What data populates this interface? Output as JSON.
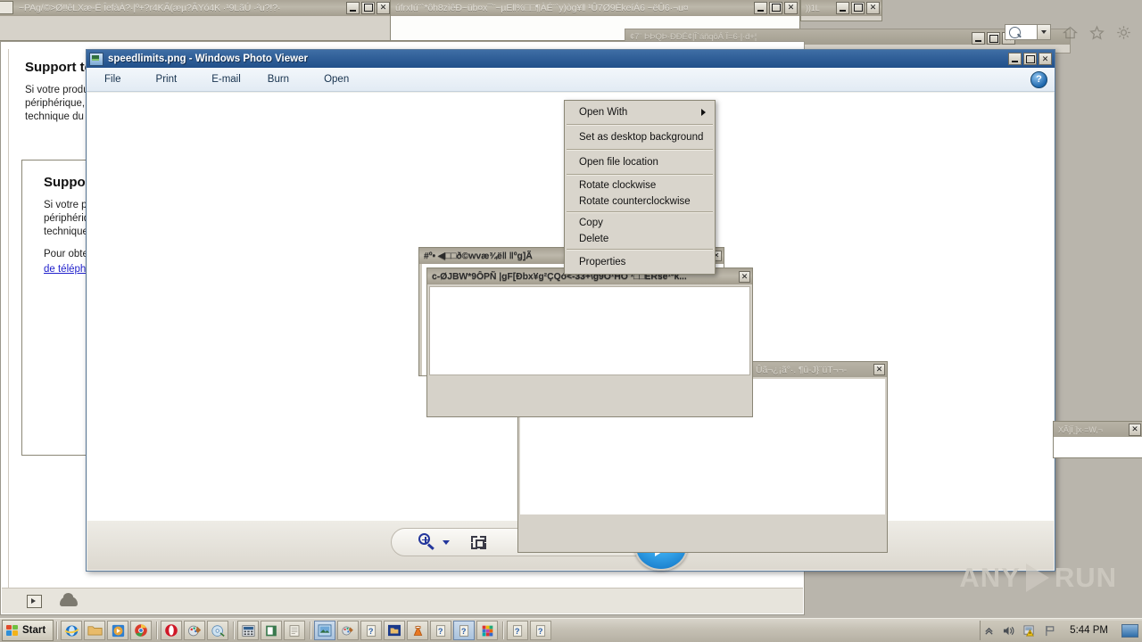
{
  "desktop": {
    "background_color": "#b9b5ac"
  },
  "background_windows": [
    {
      "title": "~PAg/©>Ø‼êLXæ-Ë ÎefàÀ?·|º+?r4KÃ(æµ?ÃYó4K ·¹9LãÚ ·²u?!?·",
      "controls": [
        "minimize",
        "maximize",
        "close"
      ]
    },
    {
      "title": "úfrxIú¨`*ôh8zìêÐ~üb¤x¯¨~µE‖%□□¶ÀÉ¨`y)òg¥‖ ¹Û7Ø9ÈkeíÁ6 ~ëÛ6·¬u¤",
      "controls": [
        "minimize",
        "maximize",
        "close"
      ]
    },
    {
      "title": "))1L",
      "controls": [
        "minimize",
        "maximize",
        "close"
      ]
    },
    {
      "title": "¢7¨ ÞÞQÞ·ÐÐÉ¢|Î`áñqôÁ   Ï=6·|·ḋ+¦",
      "controls": [
        "minimize",
        "maximize",
        "close"
      ]
    },
    {
      "title": "#º• ◀□□ð©wvæ¾ë‖ ‖ºg]Ã",
      "controls": [
        "close"
      ]
    },
    {
      "title": "c-ØJBW*9ÔPÑ |gF[Ðbx¥g²ÇQó<-33+\\g9Ô¹HÒ ¹□□ËRse¹ºk...",
      "controls": [
        "close"
      ]
    },
    {
      "title": "Ûã¬¿¡ã°·. ¶û-J}¨üT¬¬-",
      "controls": [
        "close"
      ]
    },
    {
      "title": "XÃ]Ï¸]x·=W,¬",
      "controls": [
        "close"
      ]
    }
  ],
  "ie_toolbar": {
    "search_placeholder": "",
    "icons": [
      "search-icon",
      "search-dropdown",
      "home-icon",
      "favorites-star-icon",
      "settings-gear-icon"
    ]
  },
  "document": {
    "heading": "Support technique",
    "paragraph": "Si votre produit\npériphérique, l\ntechnique du k",
    "sub": {
      "heading": "Support",
      "paragraph": "Si votre pro\npériphérique\ntechnique d",
      "paragraph2": "Pour obtenir",
      "link": "de téléphon"
    },
    "footer_icons": [
      "media-icon",
      "cloud-icon"
    ]
  },
  "photo_viewer": {
    "window_title": "speedlimits.png - Windows Photo Viewer",
    "icon": "photo-viewer-icon",
    "menu": [
      {
        "label": "File",
        "has_dropdown": true
      },
      {
        "label": "Print",
        "has_dropdown": true
      },
      {
        "label": "E-mail",
        "has_dropdown": false
      },
      {
        "label": "Burn",
        "has_dropdown": true
      },
      {
        "label": "Open",
        "has_dropdown": true
      }
    ],
    "help_label": "?",
    "controls": {
      "minimize": "minimize",
      "maximize": "maximize",
      "close": "close"
    },
    "bottom_toolbar": {
      "zoom_icon": "magnifier-plus-icon",
      "fit_icon": "fit-to-window-icon",
      "play_icon": "slideshow-play-icon"
    }
  },
  "context_menu": {
    "groups": [
      [
        {
          "label": "Open With",
          "submenu": true
        }
      ],
      [
        {
          "label": "Set as desktop background",
          "submenu": false
        }
      ],
      [
        {
          "label": "Open file location",
          "submenu": false
        }
      ],
      [
        {
          "label": "Rotate clockwise",
          "submenu": false
        },
        {
          "label": "Rotate counterclockwise",
          "submenu": false
        }
      ],
      [
        {
          "label": "Copy",
          "submenu": false
        },
        {
          "label": "Delete",
          "submenu": false
        }
      ],
      [
        {
          "label": "Properties",
          "submenu": false
        }
      ]
    ]
  },
  "taskbar": {
    "start_label": "Start",
    "quick_launch": [
      {
        "name": "internet-explorer-icon"
      },
      {
        "name": "folder-icon"
      },
      {
        "name": "media-player-icon"
      },
      {
        "name": "chrome-icon"
      },
      {
        "name": "opera-icon"
      },
      {
        "name": "paint-icon"
      },
      {
        "name": "disc-icon"
      },
      {
        "name": "calculator-icon"
      },
      {
        "name": "notepad-icon"
      },
      {
        "name": "document-icon"
      }
    ],
    "tasks": [
      {
        "name": "photo-viewer-task",
        "active": true
      },
      {
        "name": "paint-task",
        "active": false
      },
      {
        "name": "unknown-doc-task-1",
        "active": false
      },
      {
        "name": "folder-task",
        "active": false
      },
      {
        "name": "vlc-task",
        "active": false
      },
      {
        "name": "unknown-doc-task-2",
        "active": false
      },
      {
        "name": "unknown-doc-task-3",
        "active": true
      },
      {
        "name": "colors-task",
        "active": false
      },
      {
        "name": "unknown-doc-task-4",
        "active": false
      },
      {
        "name": "unknown-doc-task-5",
        "active": false
      }
    ],
    "tray": {
      "icons": [
        "show-hidden-icons",
        "volume-icon",
        "security-warning-icon",
        "network-flag-icon"
      ],
      "clock": "5:44 PM",
      "show-desktop": "show-desktop-icon"
    }
  },
  "watermark": {
    "left": "ANY",
    "right": "RUN"
  }
}
